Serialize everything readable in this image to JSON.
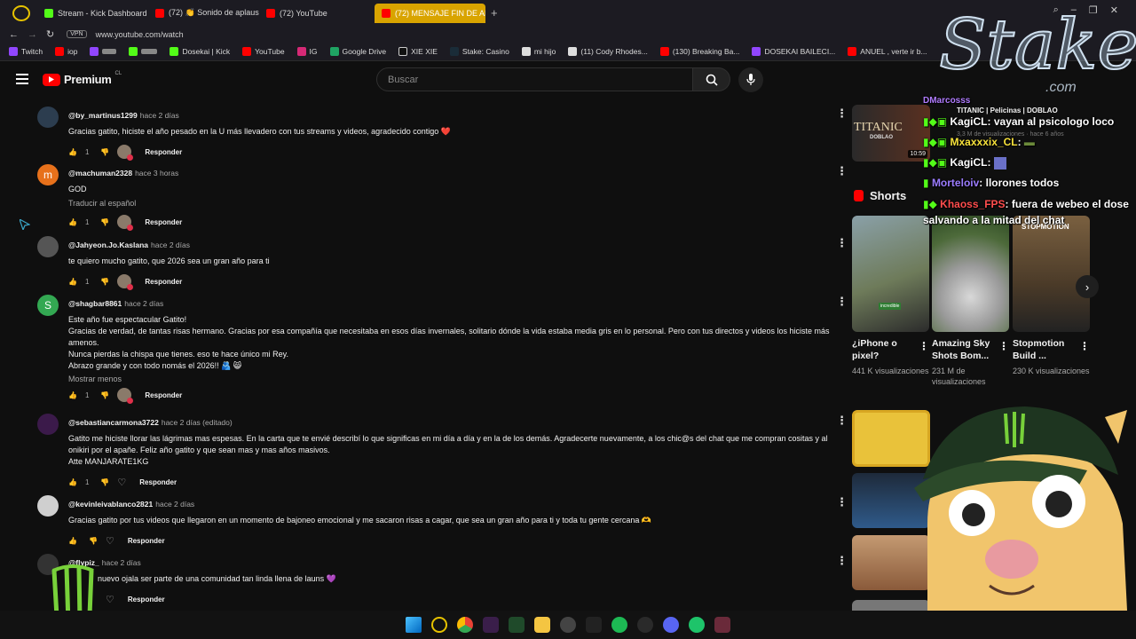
{
  "browser": {
    "tabs": [
      {
        "label": "Stream - Kick Dashboard",
        "color": "#53fc18"
      },
      {
        "label": "(72) 👏 Sonido de aplauso",
        "color": "#ff0000"
      },
      {
        "label": "(72) YouTube",
        "color": "#ff0000"
      },
      {
        "label": "(72) MENSAJE FIN DE AÑ",
        "color": "#ff0000",
        "active": true
      }
    ],
    "vpn_label": "VPN",
    "url": "www.youtube.com/watch",
    "bookmarks": [
      "Twitch",
      "iop",
      "",
      "",
      "Dosekai | Kick",
      "YouTube",
      "IG",
      "Google Drive",
      "XIE XIE",
      "Stake: Casino",
      "mi hijo",
      "(11) Cody Rhodes...",
      "(130) Breaking Ba...",
      "DOSEKAI BAILECI...",
      "ANUEL , verte ir b..."
    ]
  },
  "youtube": {
    "logo": "Premium",
    "region": "CL",
    "search_placeholder": "Buscar"
  },
  "comments": [
    {
      "author": "@by_martinus1299",
      "time": "hace 2 días",
      "text": [
        "Gracias gatito, hiciste el año pesado en la U más llevadero con tus streams y videos, agradecido contigo ❤️"
      ],
      "likes": "1",
      "reply": "Responder",
      "avatar_color": "#2c3d4f",
      "avatar_letter": ""
    },
    {
      "author": "@machuman2328",
      "time": "hace 3 horas",
      "text": [
        "GOD"
      ],
      "translate": "Traducir al español",
      "likes": "1",
      "reply": "Responder",
      "avatar_color": "#e7711b",
      "avatar_letter": "m"
    },
    {
      "author": "@Jahyeon.Jo.Kaslana",
      "time": "hace 2 días",
      "text": [
        "te quiero mucho gatito, que 2026 sea un gran año para ti"
      ],
      "likes": "1",
      "reply": "Responder",
      "avatar_color": "#555555",
      "avatar_letter": ""
    },
    {
      "author": "@shagbar8861",
      "time": "hace 2 días",
      "text": [
        "Este año fue espectacular Gatito!",
        "Gracias de verdad, de tantas risas hermano. Gracias por esa compañía que necesitaba en esos días invernales, solitario dónde la vida estaba media gris en lo personal. Pero con tus directos y videos los hiciste más amenos.",
        "Nunca pierdas la chispa que tienes. eso te hace único mi Rey.",
        "Abrazo grande y con todo nomás el 2026!! 🫂 😸"
      ],
      "show_less": "Mostrar menos",
      "likes": "1",
      "reply": "Responder",
      "avatar_color": "#33a852",
      "avatar_letter": "S"
    },
    {
      "author": "@sebastiancarmona3722",
      "time": "hace 2 días (editado)",
      "text": [
        "Gatito me hiciste llorar las lágrimas mas espesas. En la carta que te envié describí lo que significas en mi día a día y en la de los demás. Agradecerte nuevamente, a los chic@s del chat que me compran cositas y al onikiri por el apañe. Feliz año gatito y que sean mas y mas años masivos.",
        "Atte MANJARATE1KG"
      ],
      "likes": "1",
      "reply": "Responder",
      "avatar_color": "#3b1a4a",
      "avatar_letter": ""
    },
    {
      "author": "@kevinleivablanco2821",
      "time": "hace 2 días",
      "text": [
        "Gracias gatito por tus videos que llegaron en un momento de bajoneo emocional y me sacaron risas a cagar, que sea un gran año para ti y toda tu gente cercana 🫶"
      ],
      "likes": "",
      "reply": "Responder",
      "avatar_color": "#cfcfcf",
      "avatar_letter": ""
    },
    {
      "author": "@flypiz_",
      "time": "hace 2 días",
      "text": [
        "nuevo ojala ser parte de una comunidad tan linda llena de launs 💜"
      ],
      "likes": "",
      "reply": "Responder",
      "avatar_color": "#333333",
      "avatar_letter": ""
    }
  ],
  "sidebar": {
    "video_top": {
      "title": "TITANIC | Pelicinas | DOBLAO",
      "views": "3,3 M de visualizaciones · hace 6 años",
      "thumb_text": "TITANIC",
      "thumb_sub": "DOBLAO",
      "duration": "10:59"
    },
    "shorts_title": "Shorts",
    "shorts": [
      {
        "title": "¿iPhone o pixel?",
        "views": "441 K visualizaciones",
        "color": "#6e7b5a",
        "badge": "incredible"
      },
      {
        "title": "Amazing Sky Shots Bom...",
        "views": "231 M de visualizaciones",
        "color": "#8aa07a",
        "badge": ""
      },
      {
        "title": "Stopmotion Build ...",
        "views": "230 K visualizaciones",
        "color": "#5c4a33",
        "badge": "STOPMOTION"
      }
    ]
  },
  "overlay": {
    "brand": "Stake",
    "brand_sub": ".com",
    "chat": [
      {
        "user": "DMarcosss",
        "text": "",
        "color": "#b07cff"
      },
      {
        "user": "KagiCL",
        "text": ": vayan al psicologo loco",
        "color": "#ffffff"
      },
      {
        "user": "Mxaxxxix_CL",
        "text": ":",
        "color": "#f7e23b"
      },
      {
        "user": "KagiCL",
        "text": ":",
        "color": "#ffffff"
      },
      {
        "user": "Morteloiv",
        "text": ": llorones todos",
        "color": "#9b7cff"
      },
      {
        "user": "Khaoss_FPS",
        "text": ": fuera de webeo el dose salvando a la mitad del chat",
        "color": "#ff4d4d"
      }
    ]
  },
  "colors": {
    "yt_red": "#ff0000",
    "kick_green": "#53fc18",
    "monster_green": "#78d13a"
  }
}
